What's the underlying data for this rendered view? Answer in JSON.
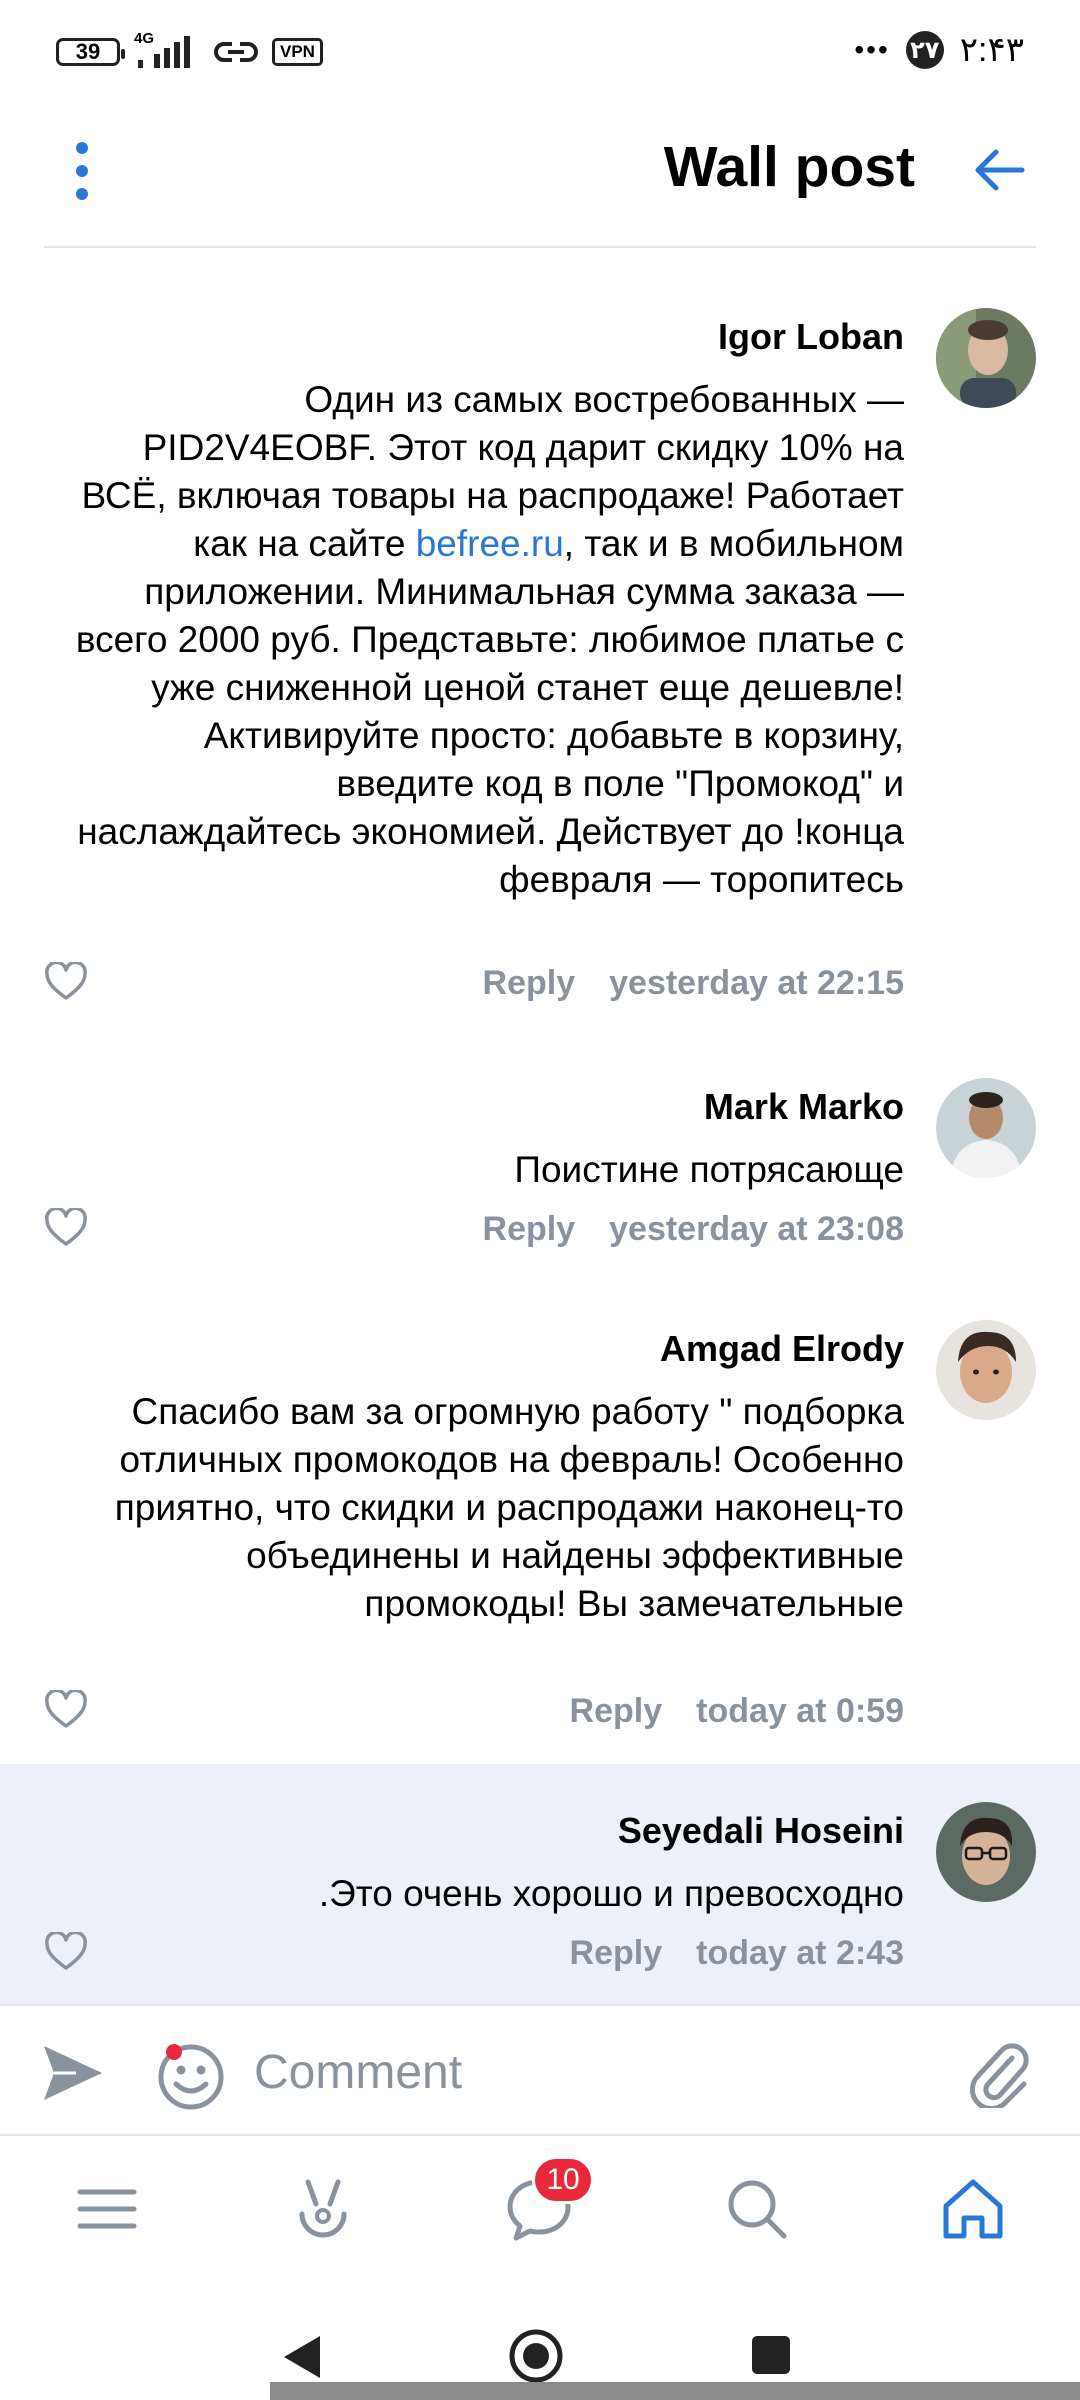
{
  "status_bar": {
    "battery": "39",
    "network": "4G",
    "vpn": "VPN",
    "notification_count": "۲۷",
    "time": "۲:۴۳"
  },
  "header": {
    "title": "Wall post"
  },
  "comments": [
    {
      "author": "Igor Loban",
      "text_before_link": "Один из самых востребованных — PID2V4EOBF. Этот код дарит скидку 10% на ВСЁ, включая товары на распродаже! Работает как на сайте ",
      "link": "befree.ru",
      "text_after_link": ", так и в мобильном приложении. Минимальная сумма заказа — всего 2000 руб. Представьте: любимое платье с уже сниженной ценой станет еще дешевле! Активируйте просто: добавьте в корзину, введите код в поле \"Промокод\" и наслаждайтесь экономией. Действует до !конца февраля — торопитесь",
      "reply_label": "Reply",
      "timestamp": "yesterday at 22:15"
    },
    {
      "author": "Mark Marko",
      "text": "Поистине потрясающе",
      "reply_label": "Reply",
      "timestamp": "yesterday at 23:08"
    },
    {
      "author": "Amgad Elrody",
      "text": "Спасибо вам за огромную работу \" подборка отличных промокодов на февраль! Особенно приятно, что скидки и распродажи наконец-то объединены и найдены эффективные промокоды! Вы замечательные",
      "reply_label": "Reply",
      "timestamp": "today at 0:59"
    },
    {
      "author": "Seyedali Hoseini",
      "text": ".Это очень хорошо и превосходно",
      "reply_label": "Reply",
      "timestamp": "today at 2:43"
    }
  ],
  "composer": {
    "placeholder": "Comment"
  },
  "bottom_nav": {
    "items": [
      "menu-icon",
      "services-icon",
      "messages-icon",
      "search-icon",
      "home-icon"
    ],
    "messages_badge": "10",
    "active": "home-icon"
  },
  "colors": {
    "accent": "#2a78d6",
    "muted": "#8a939d",
    "highlight_bg": "#edf1f7",
    "badge": "#e8293b"
  }
}
